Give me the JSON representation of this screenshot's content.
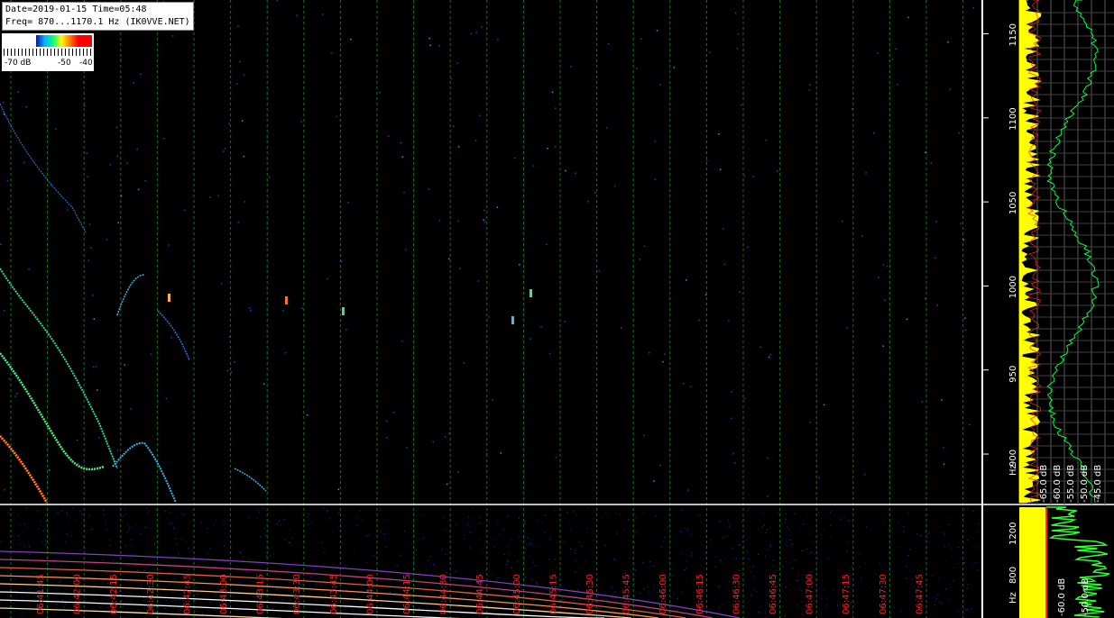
{
  "header": {
    "date_line": "Date=2019-01-15 Time=05:48",
    "freq_line": "Freq= 870...1170.1 Hz (IK0VVE.NET)"
  },
  "color_scale": {
    "labels": [
      "-70 dB",
      "-50",
      "-40"
    ]
  },
  "chart_data": [
    {
      "type": "heatmap",
      "title": "",
      "y_unit": "Hz",
      "y_ticks": [
        1150,
        1100,
        1050,
        1000,
        950,
        900
      ],
      "ylim": [
        870,
        1170.1
      ],
      "right_panel_db_labels": [
        "-65.0 dB",
        "-60.0 dB",
        "-55.0 dB",
        "-50.0 dB",
        "-45.0 dB"
      ],
      "grid": true,
      "colors": {
        "grid": "#1f6f1f",
        "trace_primary": "#ffff00",
        "trace_secondary": "#00ff40",
        "trace_red": "#ff2020"
      }
    },
    {
      "type": "heatmap",
      "title": "",
      "x_tick_labels": [
        "06:41:45",
        "06:42:00",
        "06:42:15",
        "06:42:30",
        "06:42:45",
        "06:43:00",
        "06:43:15",
        "06:43:30",
        "06:43:45",
        "06:44:00",
        "06:44:15",
        "06:44:30",
        "06:44:45",
        "06:45:00",
        "06:45:15",
        "06:45:30",
        "06:45:45",
        "06:46:00",
        "06:46:15",
        "06:46:30",
        "06:46:45",
        "06:47:00",
        "06:47:15",
        "06:47:30",
        "06:47:45"
      ],
      "y_ticks": [
        1200,
        800
      ],
      "y_unit": "Hz",
      "right_panel_db_labels": [
        "-60.0 dB",
        "-50.0 dB"
      ],
      "colors": {
        "x_labels": "#ff2020"
      }
    }
  ]
}
